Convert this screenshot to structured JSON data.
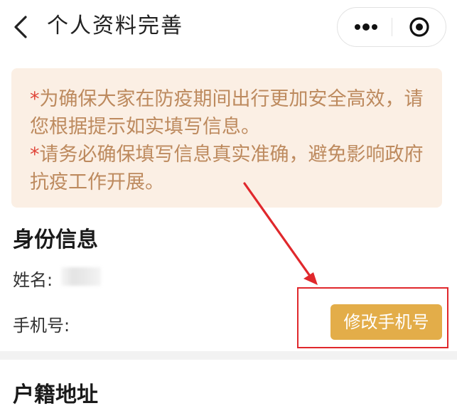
{
  "header": {
    "title": "个人资料完善",
    "back_icon": "chevron-left-icon",
    "more_icon": "more-dots-icon",
    "close_icon": "target-circle-icon"
  },
  "notice": {
    "line1_star": "*",
    "line1_text": "为确保大家在防疫期间出行更加安全高效，请您根据提示如实填写信息。",
    "line2_star": "*",
    "line2_text": "请务必确保填写信息真实准确，避免影响政府抗疫工作开展。"
  },
  "identity": {
    "section_title": "身份信息",
    "name_label": "姓名:",
    "phone_label": "手机号:",
    "change_phone_button": "修改手机号"
  },
  "address": {
    "section_title": "户籍地址"
  },
  "colors": {
    "notice_bg": "#fbefe4",
    "notice_text": "#bd8a5e",
    "button_bg": "#e3ad49",
    "annotation_red": "#e0282c"
  }
}
